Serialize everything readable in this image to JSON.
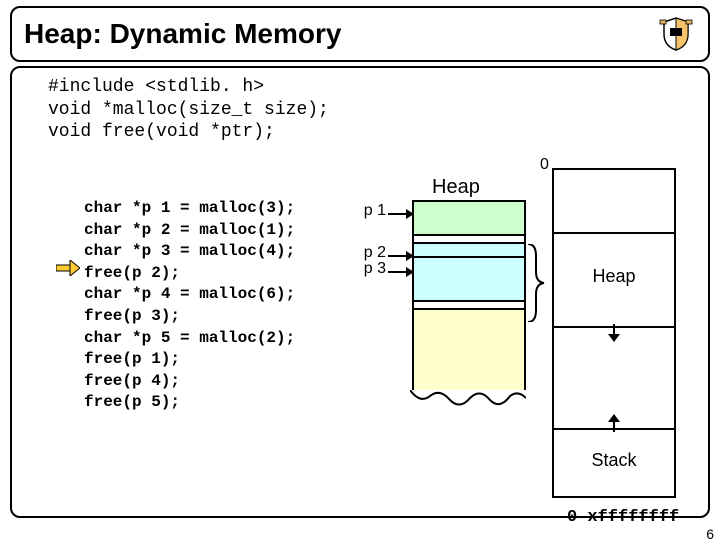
{
  "title": "Heap: Dynamic Memory",
  "includes": "#include <stdlib. h>\nvoid *malloc(size_t size);\nvoid free(void *ptr);",
  "code": "char *p 1 = malloc(3);\nchar *p 2 = malloc(1);\nchar *p 3 = malloc(4);\nfree(p 2);\nchar *p 4 = malloc(6);\nfree(p 3);\nchar *p 5 = malloc(2);\nfree(p 1);\nfree(p 4);\nfree(p 5);",
  "heap": {
    "title": "Heap",
    "zero": "0",
    "ptrs": {
      "p1": "p 1",
      "p2": "p 2",
      "p3": "p 3"
    },
    "addr": "0 xffffffff"
  },
  "memmap": {
    "heap": "Heap",
    "stack": "Stack"
  },
  "slide_number": "6"
}
